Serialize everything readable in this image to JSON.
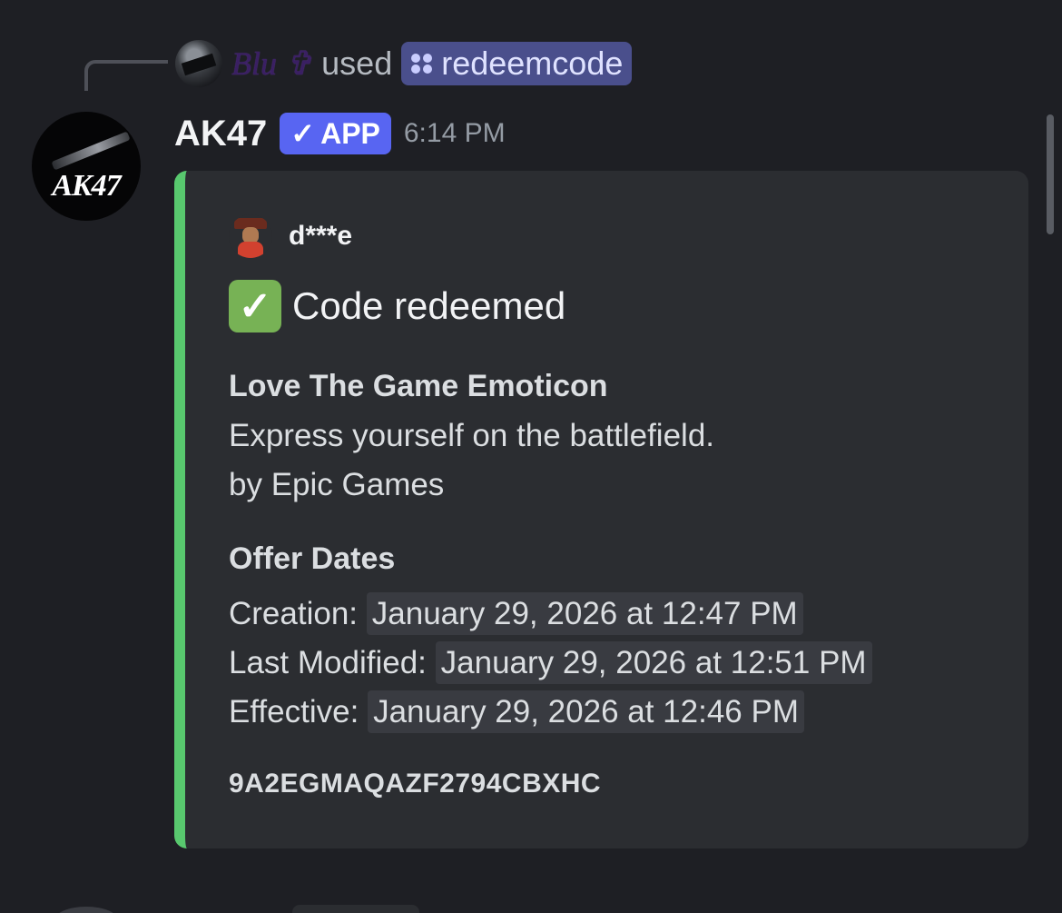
{
  "reply": {
    "user_name": "Blu ✞",
    "used_text": "used",
    "command": "redeemcode",
    "command_icon": "app-command-icon"
  },
  "message": {
    "username": "AK47",
    "avatar_text": "AK47",
    "badge_label": "APP",
    "badge_check": "✓",
    "timestamp": "6:14 PM"
  },
  "embed": {
    "accent_color": "#58c86e",
    "author_name": "d***e",
    "title_emoji": "✓",
    "title": "Code redeemed",
    "item_name": "Love The Game Emoticon",
    "item_description": "Express yourself on the battlefield.",
    "item_publisher": "by Epic Games",
    "offer_dates_heading": "Offer Dates",
    "dates": [
      {
        "label": "Creation:",
        "value": "January 29, 2026 at 12:47 PM"
      },
      {
        "label": "Last Modified:",
        "value": "January 29, 2026 at 12:51 PM"
      },
      {
        "label": "Effective:",
        "value": "January 29, 2026 at 12:46 PM"
      }
    ],
    "code": "9A2EGMAQAZF2794CBXHC"
  },
  "colors": {
    "background": "#1e1f24",
    "embed_background": "#2b2d31",
    "app_badge": "#5865f2",
    "command_pill": "#4a4f8c"
  }
}
